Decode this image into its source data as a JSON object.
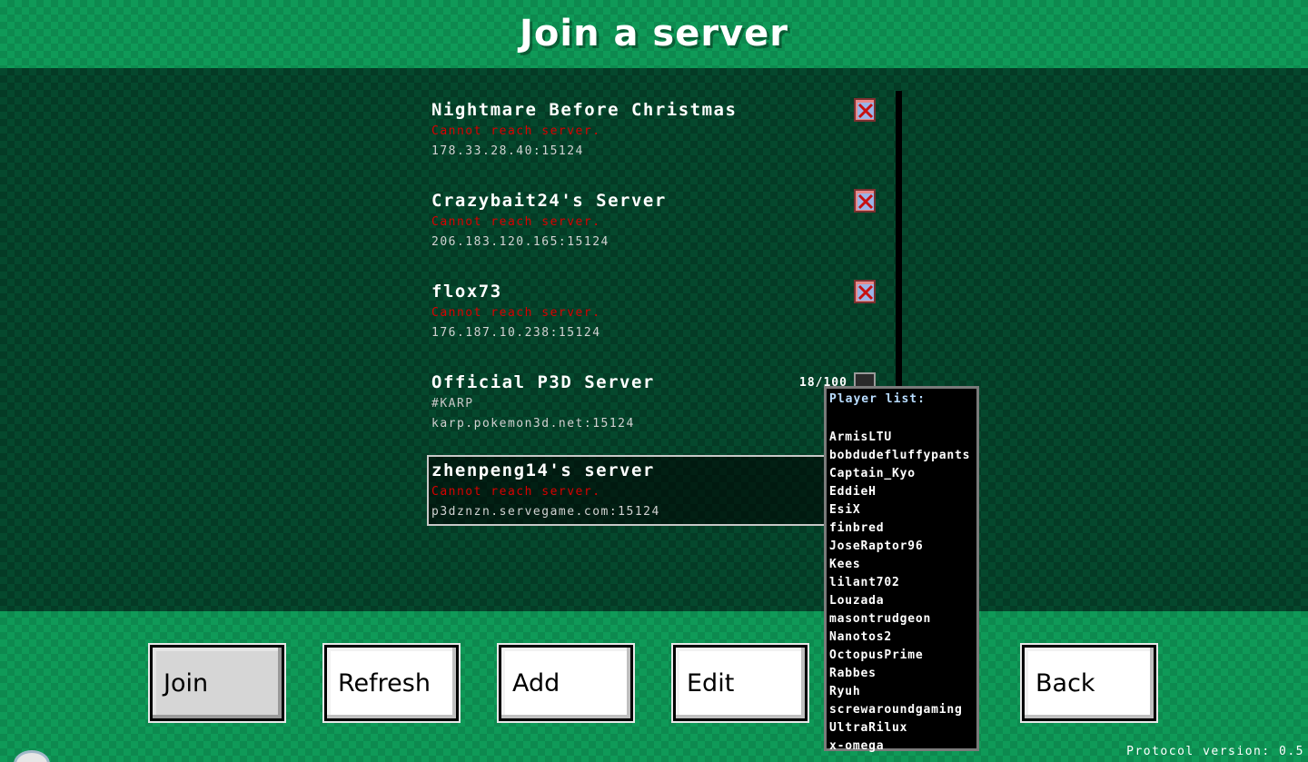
{
  "title": "Join a server",
  "servers": [
    {
      "name": "Nightmare Before Christmas",
      "status": "Cannot reach server.",
      "address": "178.33.28.40:15124",
      "icon": "unreachable-x-icon"
    },
    {
      "name": "Crazybait24's Server",
      "status": "Cannot reach server.",
      "address": "206.183.120.165:15124",
      "icon": "unreachable-x-icon"
    },
    {
      "name": "flox73",
      "status": "Cannot reach server.",
      "address": "176.187.10.238:15124",
      "icon": "unreachable-x-icon"
    },
    {
      "name": "Official P3D Server",
      "status": "#KARP",
      "address": "karp.pokemon3d.net:15124",
      "players": "18/100",
      "icon": "signal-strength-icon"
    },
    {
      "name": "zhenpeng14's server",
      "status": "Cannot reach server.",
      "address": "p3dznzn.servegame.com:15124",
      "selected": true
    }
  ],
  "tooltip": {
    "title": "Player list:",
    "players": [
      "ArmisLTU",
      "bobdudefluffypants",
      "Captain_Kyo",
      "EddieH",
      "EsiX",
      "finbred",
      "JoseRaptor96",
      "Kees",
      "lilant702",
      "Louzada",
      "masontrudgeon",
      "Nanotos2",
      "OctopusPrime",
      "Rabbes",
      "Ryuh",
      "screwaroundgaming",
      "UltraRilux",
      "x-omega"
    ]
  },
  "buttons": {
    "join": "Join",
    "refresh": "Refresh",
    "add": "Add",
    "edit": "Edit",
    "back": "Back"
  },
  "protocol_version": "Protocol version: 0.5",
  "colors": {
    "error": "#d90000",
    "background": "#0f9a58",
    "list_background": "#05482d"
  }
}
